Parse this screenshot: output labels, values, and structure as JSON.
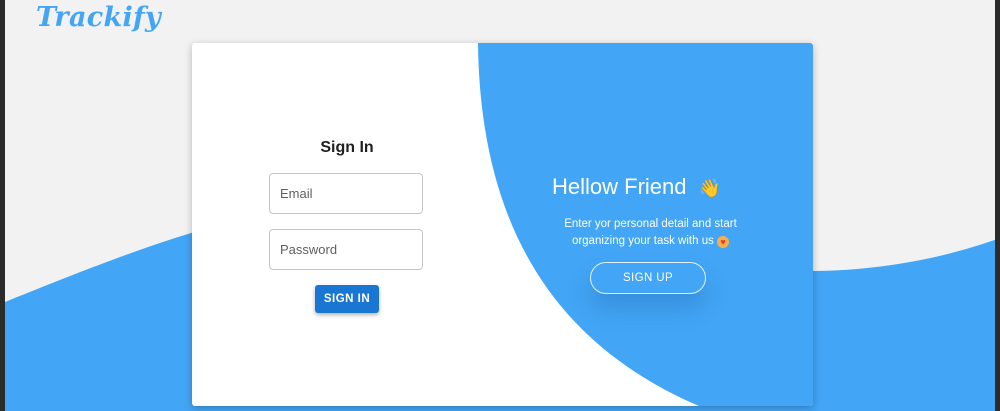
{
  "app": {
    "logo_text": "Trackify"
  },
  "signin": {
    "title": "Sign In",
    "email_placeholder": "Email",
    "password_placeholder": "Password",
    "button_label": "SIGN IN"
  },
  "welcome": {
    "heading": "Hellow Friend",
    "heading_icon": "waving-hand-icon",
    "line1": "Enter yor personal detail and start",
    "line2": "organizing your task with us",
    "line2_icon": "smiling-face-with-hearts-icon",
    "signup_label": "SIGN UP"
  },
  "colors": {
    "accent": "#42a5f5",
    "primary_button": "#1976d2",
    "page_bg": "#f2f2f2"
  }
}
